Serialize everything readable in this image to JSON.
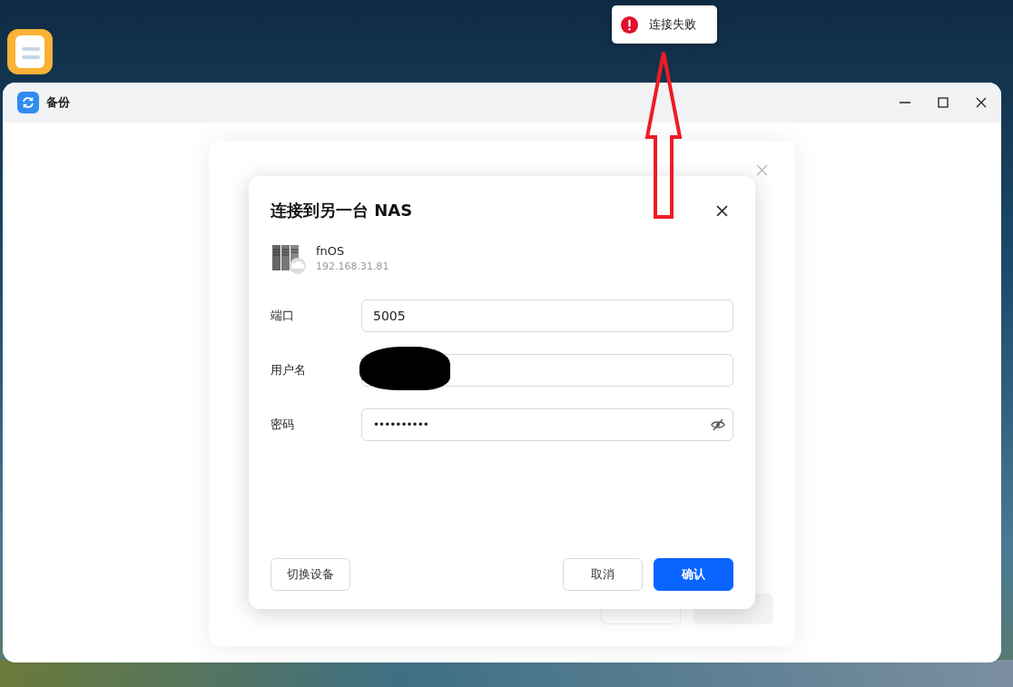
{
  "toast": {
    "kind": "error",
    "message": "连接失败"
  },
  "window": {
    "title": "备份"
  },
  "dialog": {
    "title": "连接到另一台 NAS",
    "device": {
      "name": "fnOS",
      "address": "192.168.31.81"
    },
    "fields": [
      {
        "label": "端口",
        "kind": "text",
        "value": "5005",
        "redacted": false
      },
      {
        "label": "用户名",
        "kind": "text",
        "redacted": true
      },
      {
        "label": "密码",
        "kind": "password",
        "value": "••••••••••",
        "redacted": false
      }
    ],
    "footer": {
      "left": [
        {
          "label": "切换设备"
        }
      ],
      "right": [
        {
          "label": "取消",
          "kind": "secondary"
        },
        {
          "label": "确认",
          "kind": "primary"
        }
      ]
    }
  }
}
